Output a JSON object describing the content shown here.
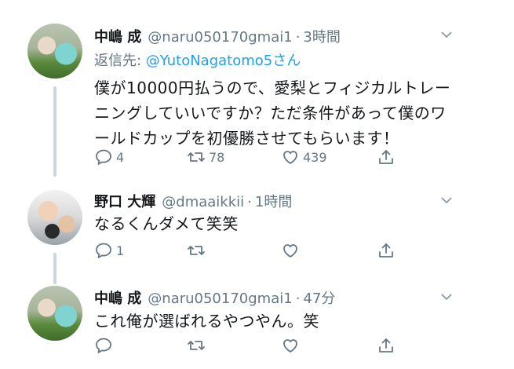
{
  "tweets": [
    {
      "name": "中嶋 成",
      "handle": "@naru050170gmai1",
      "time": "3時間",
      "reply_prefix": "返信先: ",
      "reply_to": "@YutoNagatomo5さん",
      "lines": [
        "僕が10000円払うので、愛梨とフィジカルトレー",
        "ニングしていいですか？ただ条件があって僕のワ",
        "ールドカップを初優勝させてもらいます！"
      ],
      "replies": "4",
      "retweets": "78",
      "likes": "439"
    },
    {
      "name": "野口 大輝",
      "handle": "@dmaaikkii",
      "time": "1時間",
      "lines": [
        "なるくんダメて笑笑"
      ],
      "replies": "1",
      "retweets": "",
      "likes": ""
    },
    {
      "name": "中嶋 成",
      "handle": "@naru050170gmai1",
      "time": "47分",
      "lines": [
        "これ俺が選ばれるやつやん。笑"
      ],
      "replies": "",
      "retweets": "",
      "likes": ""
    }
  ],
  "colors": {
    "text": "#14171a",
    "muted": "#657786",
    "link": "#1da1f2",
    "thread_line": "#ccd6dd"
  },
  "icons": [
    "chevron-down-icon",
    "reply-icon",
    "retweet-icon",
    "like-icon",
    "share-icon"
  ]
}
